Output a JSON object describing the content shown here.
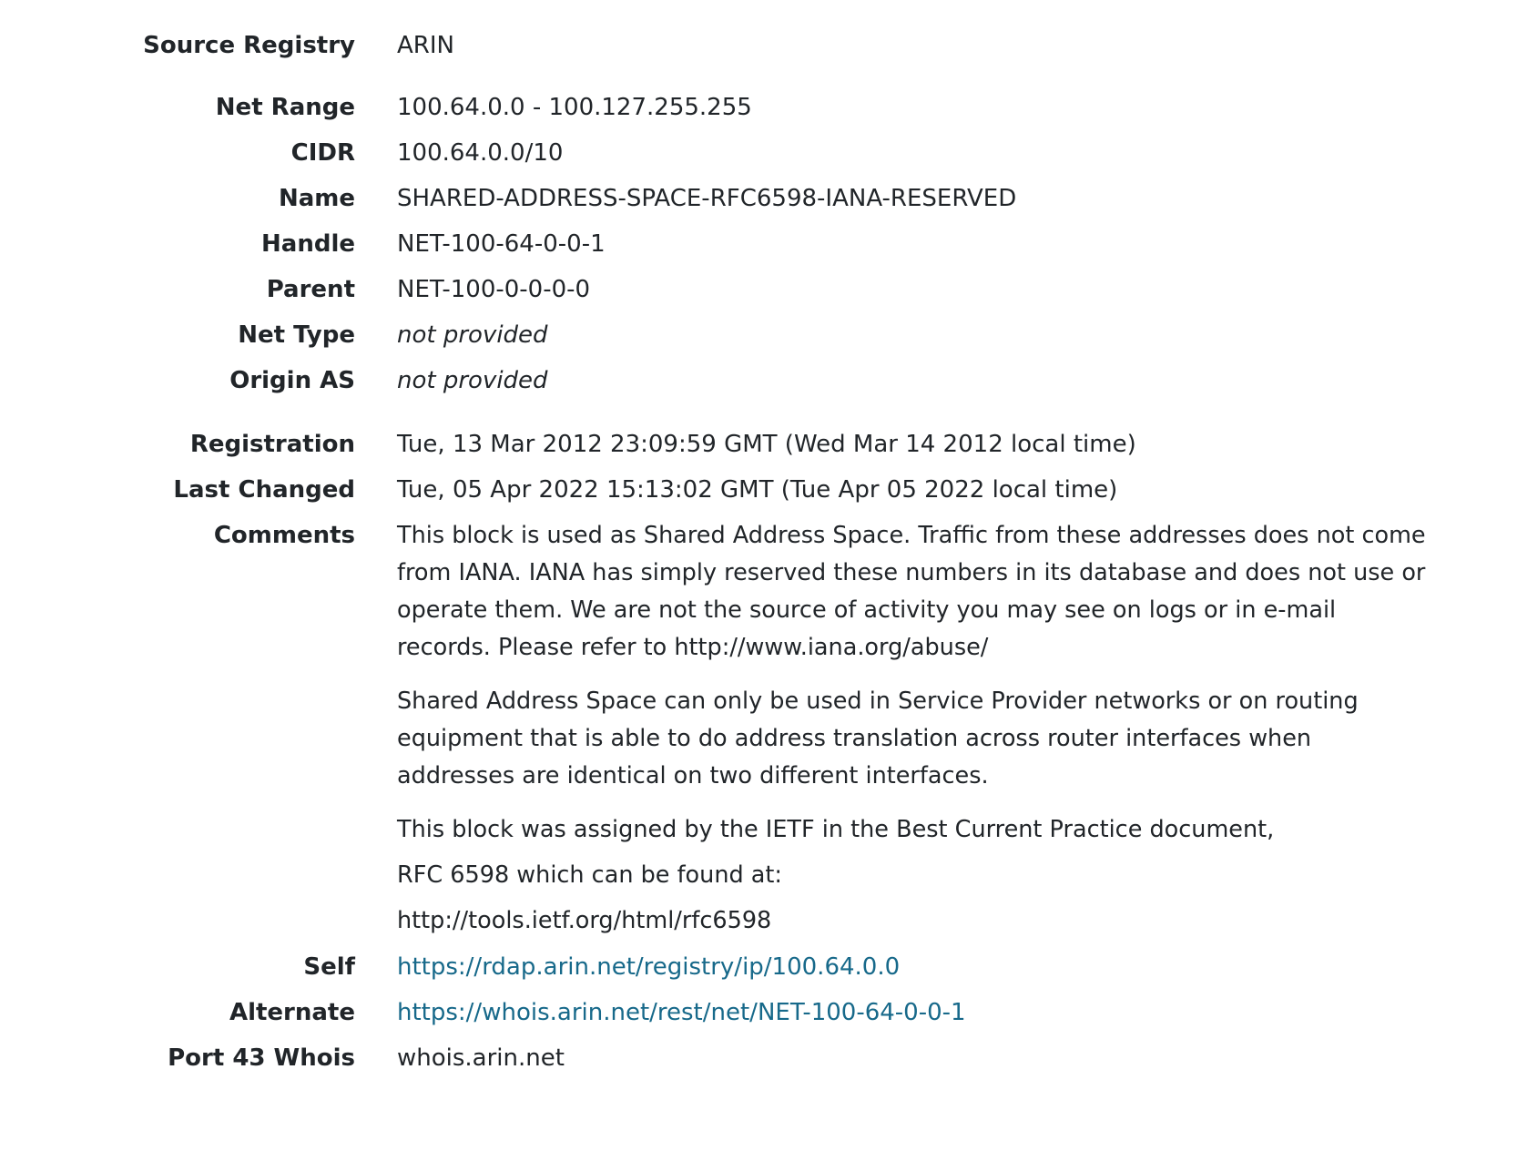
{
  "fields": {
    "source_registry": {
      "label": "Source Registry",
      "value": "ARIN"
    },
    "net_range": {
      "label": "Net Range",
      "value": "100.64.0.0 - 100.127.255.255"
    },
    "cidr": {
      "label": "CIDR",
      "value": "100.64.0.0/10"
    },
    "name": {
      "label": "Name",
      "value": "SHARED-ADDRESS-SPACE-RFC6598-IANA-RESERVED"
    },
    "handle": {
      "label": "Handle",
      "value": "NET-100-64-0-0-1"
    },
    "parent": {
      "label": "Parent",
      "value": "NET-100-0-0-0-0"
    },
    "net_type": {
      "label": "Net Type",
      "value": "not provided"
    },
    "origin_as": {
      "label": "Origin AS",
      "value": "not provided"
    },
    "registration": {
      "label": "Registration",
      "value": "Tue, 13 Mar 2012 23:09:59 GMT (Wed Mar 14 2012 local time)"
    },
    "last_changed": {
      "label": "Last Changed",
      "value": "Tue, 05 Apr 2022 15:13:02 GMT (Tue Apr 05 2022 local time)"
    },
    "comments": {
      "label": "Comments",
      "paragraphs": [
        "This block is used as Shared Address Space. Traffic from these addresses does not come from IANA. IANA has simply reserved these numbers in its database and does not use or operate them. We are not the source of activity you may see on logs or in e-mail records. Please refer to http://www.iana.org/abuse/",
        "Shared Address Space can only be used in Service Provider networks or on routing equipment that is able to do address translation across router interfaces when addresses are identical on two different interfaces.",
        "This block was assigned by the IETF in the Best Current Practice document,",
        "RFC 6598 which can be found at:",
        "http://tools.ietf.org/html/rfc6598"
      ]
    },
    "self": {
      "label": "Self",
      "value": "https://rdap.arin.net/registry/ip/100.64.0.0"
    },
    "alternate": {
      "label": "Alternate",
      "value": "https://whois.arin.net/rest/net/NET-100-64-0-0-1"
    },
    "port43": {
      "label": "Port 43 Whois",
      "value": "whois.arin.net"
    }
  },
  "colors": {
    "text": "#212529",
    "link": "#17698a"
  }
}
